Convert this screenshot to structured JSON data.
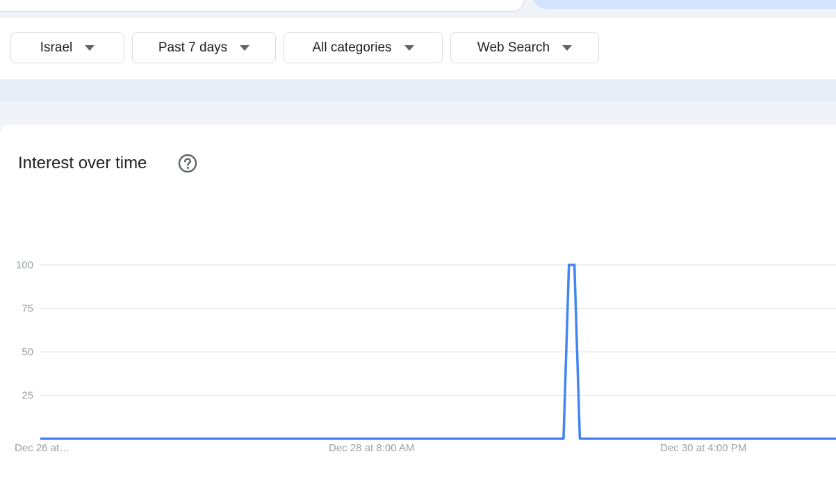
{
  "filters": [
    {
      "label": "Israel"
    },
    {
      "label": "Past 7 days"
    },
    {
      "label": "All categories"
    },
    {
      "label": "Web Search"
    }
  ],
  "card": {
    "title": "Interest over time",
    "help_icon": "help-circle-icon"
  },
  "colors": {
    "series": "#4285f4",
    "grid": "#e0e0e0",
    "tick": "#9aa0a6"
  },
  "chart_data": {
    "type": "line",
    "title": "",
    "xlabel": "",
    "ylabel": "",
    "ylim": [
      0,
      100
    ],
    "yticks": [
      25,
      50,
      75,
      100
    ],
    "xtick_labels": [
      "Dec 26 at…",
      "Dec 28 at 8:00 AM",
      "Dec 30 at 4:00 PM"
    ],
    "grid": true,
    "series": [
      {
        "x": [
          0,
          96,
          97,
          98,
          99,
          146
        ],
        "y": [
          0,
          0,
          100,
          100,
          0,
          0
        ]
      }
    ]
  }
}
